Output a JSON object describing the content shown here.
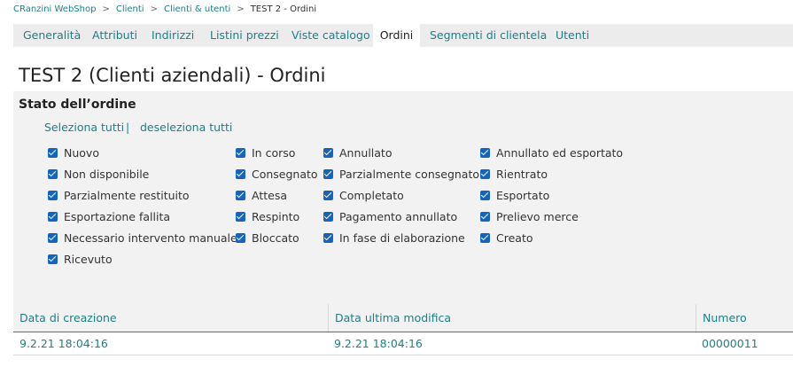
{
  "breadcrumb": {
    "items": [
      "CRanzini WebShop",
      "Clienti",
      "Clienti & utenti",
      "TEST 2 - Ordini"
    ],
    "separator": ">"
  },
  "tabs": [
    {
      "label": "Generalità"
    },
    {
      "label": "Attributi"
    },
    {
      "label": "Indirizzi"
    },
    {
      "label": "Listini prezzi"
    },
    {
      "label": "Viste catalogo"
    },
    {
      "label": "Ordini",
      "active": true
    },
    {
      "label": "Segmenti di clientela"
    },
    {
      "label": "Utenti"
    }
  ],
  "page": {
    "title": "TEST 2 (Clienti aziendali) - Ordini"
  },
  "order_status": {
    "title": "Stato dell’ordine",
    "select_all": "Seleziona tutti",
    "separator": "|",
    "deselect_all": "deseleziona tutti",
    "options": [
      {
        "label": "Nuovo",
        "checked": true
      },
      {
        "label": "In corso",
        "checked": true
      },
      {
        "label": "Annullato",
        "checked": true
      },
      {
        "label": "Annullato ed esportato",
        "checked": true
      },
      {
        "label": "Non disponibile",
        "checked": true
      },
      {
        "label": "Consegnato",
        "checked": true
      },
      {
        "label": "Parzialmente consegnato",
        "checked": true
      },
      {
        "label": "Rientrato",
        "checked": true
      },
      {
        "label": "Parzialmente restituito",
        "checked": true
      },
      {
        "label": "Attesa",
        "checked": true
      },
      {
        "label": "Completato",
        "checked": true
      },
      {
        "label": "Esportato",
        "checked": true
      },
      {
        "label": "Esportazione fallita",
        "checked": true
      },
      {
        "label": "Respinto",
        "checked": true
      },
      {
        "label": "Pagamento annullato",
        "checked": true
      },
      {
        "label": "Prelievo merce",
        "checked": true
      },
      {
        "label": "Necessario intervento manuale",
        "checked": true
      },
      {
        "label": "Bloccato",
        "checked": true
      },
      {
        "label": "In fase di elaborazione",
        "checked": true
      },
      {
        "label": "Creato",
        "checked": true
      },
      {
        "label": "Ricevuto",
        "checked": true
      }
    ]
  },
  "orders_table": {
    "columns": [
      "Data di creazione",
      "Data ultima modifica",
      "Numero"
    ],
    "rows": [
      [
        "9.2.21 18:04:16",
        "9.2.21 18:04:16",
        "00000011"
      ]
    ]
  },
  "colors": {
    "accent": "#1e7f86",
    "checkbox": "#1565c0",
    "panel_bg": "#f2f2f2",
    "tab_bar_bg": "#ececec"
  },
  "icons": {
    "checkbox": "check-icon"
  }
}
